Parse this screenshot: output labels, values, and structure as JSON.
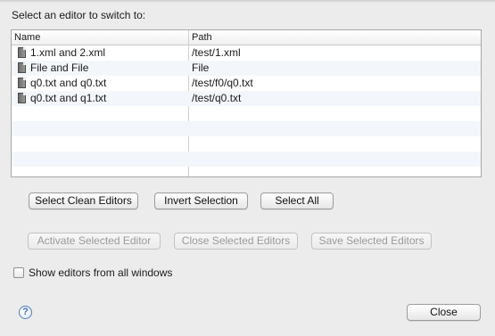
{
  "dialog": {
    "prompt": "Select an editor to switch to:"
  },
  "table": {
    "columns": [
      "Name",
      "Path"
    ],
    "rows": [
      {
        "name": "1.xml and 2.xml",
        "path": "/test/1.xml",
        "icon": "file-icon"
      },
      {
        "name": "File and File",
        "path": "File",
        "icon": "file-icon"
      },
      {
        "name": "q0.txt and q0.txt",
        "path": "/test/f0/q0.txt",
        "icon": "file-icon"
      },
      {
        "name": "q0.txt and q1.txt",
        "path": "/test/q0.txt",
        "icon": "file-icon"
      }
    ]
  },
  "buttons": {
    "select_clean": "Select Clean Editors",
    "invert_selection": "Invert Selection",
    "select_all": "Select All",
    "activate_selected": "Activate Selected Editor",
    "close_selected": "Close Selected Editors",
    "save_selected": "Save Selected Editors",
    "close": "Close"
  },
  "options": {
    "show_all_windows_label": "Show editors from all windows",
    "show_all_windows_checked": false
  },
  "help": {
    "glyph": "?"
  },
  "colors": {
    "background": "#ececec",
    "alt_row": "#f3f6fa",
    "disabled_text": "#9a9a9a"
  }
}
